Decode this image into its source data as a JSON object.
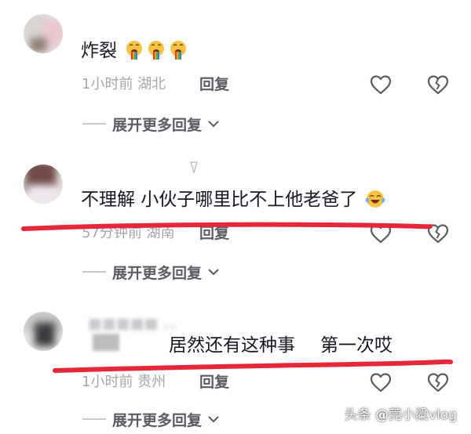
{
  "comments": [
    {
      "content": "炸裂",
      "emoji": [
        "vomit-rainbow",
        "vomit-rainbow",
        "vomit-rainbow"
      ],
      "time": "1小时前",
      "location": "湖北",
      "reply_label": "回复",
      "expand_label": "展开更多回复"
    },
    {
      "content": "不理解 小伙子哪里比不上他老爸了",
      "emoji": [
        "tears-of-joy"
      ],
      "time": "57分钟前",
      "location": "湖南",
      "reply_label": "回复",
      "expand_label": "展开更多回复"
    },
    {
      "content_part1": "居然还有这种事",
      "content_part2": "第一次哎",
      "time": "1小时前",
      "location": "贵州",
      "reply_label": "回复",
      "expand_label": "展开更多回复"
    }
  ],
  "annotations": {
    "underline_color": "#e5273a"
  },
  "colors": {
    "text": "#161823",
    "meta": "#a4a5ab",
    "accent_red": "#e5273a"
  },
  "watermark": {
    "prefix": "头条",
    "at": "@",
    "handle": "莞小粱vlog"
  }
}
